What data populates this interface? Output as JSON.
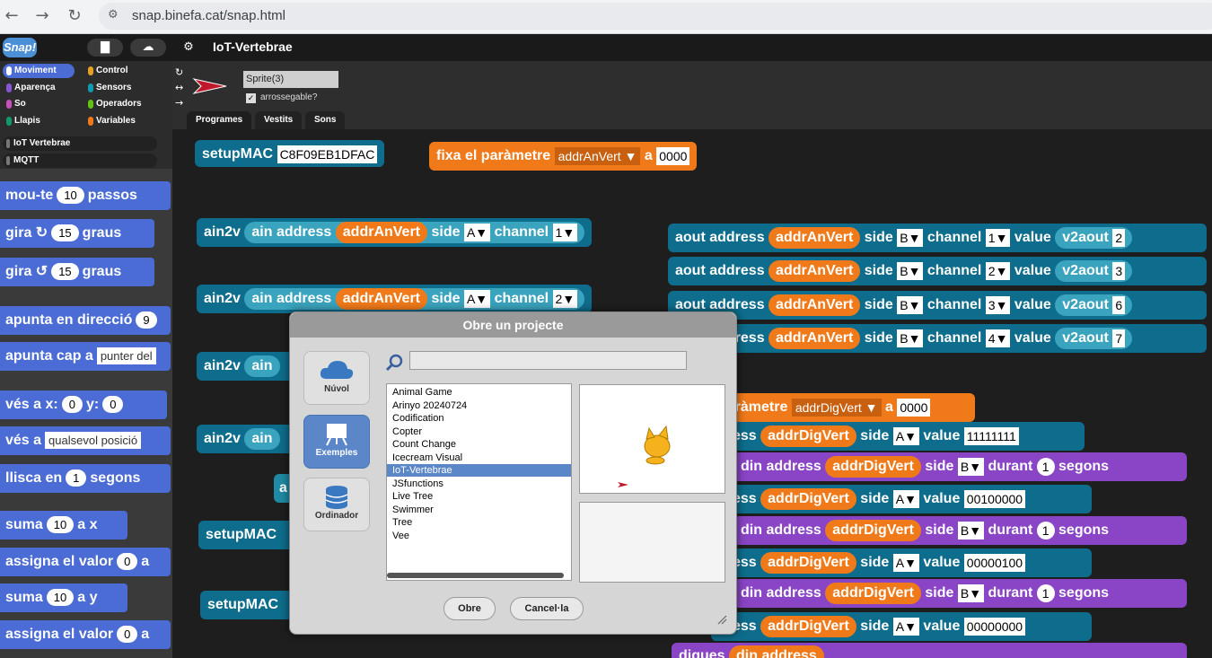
{
  "browser": {
    "back_icon": "arrow-left-icon",
    "forward_icon": "arrow-right-icon",
    "reload_icon": "reload-icon",
    "url": "snap.binefa.cat/snap.html"
  },
  "snap": {
    "logo": "Snap!",
    "project_title": "IoT-Vertebrae"
  },
  "categories": [
    {
      "label": "Moviment",
      "color": "#4a6cd4",
      "selected": true
    },
    {
      "label": "Control",
      "color": "#e6a022"
    },
    {
      "label": "Aparença",
      "color": "#8a55d7"
    },
    {
      "label": "Sensors",
      "color": "#0e9ab0"
    },
    {
      "label": "So",
      "color": "#c94fbd"
    },
    {
      "label": "Operadors",
      "color": "#62c213"
    },
    {
      "label": "Llapis",
      "color": "#0e9a6c"
    },
    {
      "label": "Variables",
      "color": "#f07a1a"
    }
  ],
  "extra_categories": [
    "IoT Vertebrae",
    "MQTT"
  ],
  "palette": [
    {
      "prefix": "mou-te",
      "v1": "10",
      "suffix": "passos"
    },
    {
      "prefix": "gira",
      "v1": "15",
      "suffix": "graus"
    },
    {
      "prefix": "gira",
      "v1": "15",
      "suffix": "graus"
    },
    {
      "prefix": "apunta en direcció",
      "v1": "9"
    },
    {
      "prefix": "apunta cap a",
      "drop": "punter del"
    },
    {
      "prefix": "vés a x:",
      "v1": "0",
      "mid": "y:",
      "v2": "0"
    },
    {
      "prefix": "vés a",
      "drop": "qualsevol posició"
    },
    {
      "prefix": "llisca en",
      "v1": "1",
      "suffix": "segons"
    },
    {
      "prefix": "suma",
      "v1": "10",
      "suffix": "a x"
    },
    {
      "prefix": "assigna el valor",
      "v1": "0",
      "suffix": "a"
    },
    {
      "prefix": "suma",
      "v1": "10",
      "suffix": "a y"
    },
    {
      "prefix": "assigna el valor",
      "v1": "0",
      "suffix": "a"
    }
  ],
  "sprite": {
    "name": "Sprite(3)",
    "draggable_check": "✓",
    "draggable_label": "arrossegable?",
    "tabs": [
      "Programes",
      "Vestits",
      "Sons"
    ]
  },
  "scripts": {
    "setupMAC": "setupMAC",
    "mac_value": "C8F09EB1DFAC",
    "fixa": "fixa el paràmetre",
    "a": "a",
    "addrAnVert": "addrAnVert",
    "addrDigVert": "addrDigVert",
    "param_value": "0000",
    "ain2v": "ain2v",
    "ain_address": "ain address",
    "aout_address": "aout address",
    "dout_address": "dress",
    "din_address": "din address",
    "side": "side",
    "channel": "channel",
    "value": "value",
    "durant": "durant",
    "segons": "segons",
    "v2aout": "v2aout",
    "param_text": "paràmetre",
    "side_a": "A",
    "side_b": "B",
    "ch1": "1",
    "ch2": "2",
    "ch3": "3",
    "ch4": "4",
    "v2": "2",
    "v3": "3",
    "v6": "6",
    "v7": "7",
    "dig1": "11111111",
    "dig2": "00100000",
    "dig3": "00000100",
    "dig4": "00000000",
    "one": "1",
    "ain_prefix": "ain",
    "a_small": "a",
    "digues": "digues",
    "din_partial": "din address"
  },
  "dialog": {
    "title": "Obre un projecte",
    "sources": [
      {
        "label": "Núvol",
        "icon": "cloud-icon"
      },
      {
        "label": "Exemples",
        "icon": "easel-icon"
      },
      {
        "label": "Ordinador",
        "icon": "database-icon"
      }
    ],
    "search_placeholder": "",
    "projects": [
      "Animal Game",
      "Arinyo 20240724",
      "Codification",
      "Copter",
      "Count Change",
      "Icecream Visual",
      "IoT-Vertebrae",
      "JSfunctions",
      "Live Tree",
      "Swimmer",
      "Tree",
      "Vee"
    ],
    "selected_project": "IoT-Vertebrae",
    "open_button": "Obre",
    "cancel_button": "Cancel·la"
  }
}
